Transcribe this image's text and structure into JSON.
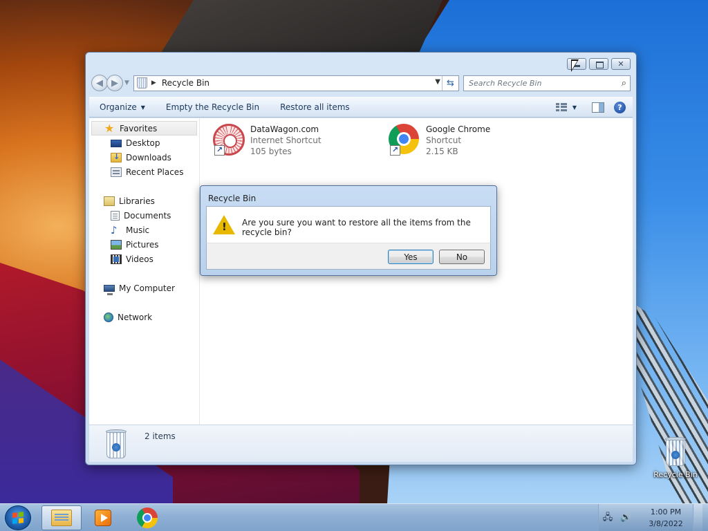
{
  "window": {
    "address_crumb": "Recycle Bin",
    "search_placeholder": "Search Recycle Bin"
  },
  "toolbar": {
    "organize": "Organize",
    "empty_bin": "Empty the Recycle Bin",
    "restore_all": "Restore all items"
  },
  "nav": {
    "favorites": "Favorites",
    "desktop": "Desktop",
    "downloads": "Downloads",
    "recent_places": "Recent Places",
    "libraries": "Libraries",
    "documents": "Documents",
    "music": "Music",
    "pictures": "Pictures",
    "videos": "Videos",
    "my_computer": "My Computer",
    "network": "Network"
  },
  "files": [
    {
      "name": "DataWagon.com",
      "type": "Internet Shortcut",
      "size": "105 bytes",
      "icon": "datawagon-icon"
    },
    {
      "name": "Google Chrome",
      "type": "Shortcut",
      "size": "2.15 KB",
      "icon": "chrome-icon"
    }
  ],
  "status": {
    "count": "2 items"
  },
  "dialog": {
    "title": "Recycle Bin",
    "message": "Are you sure you want to restore all the items from the recycle bin?",
    "yes": "Yes",
    "no": "No"
  },
  "desktop_icon": {
    "label": "Recycle Bin"
  },
  "clock": {
    "time": "1:00 PM",
    "date": "3/8/2022"
  }
}
